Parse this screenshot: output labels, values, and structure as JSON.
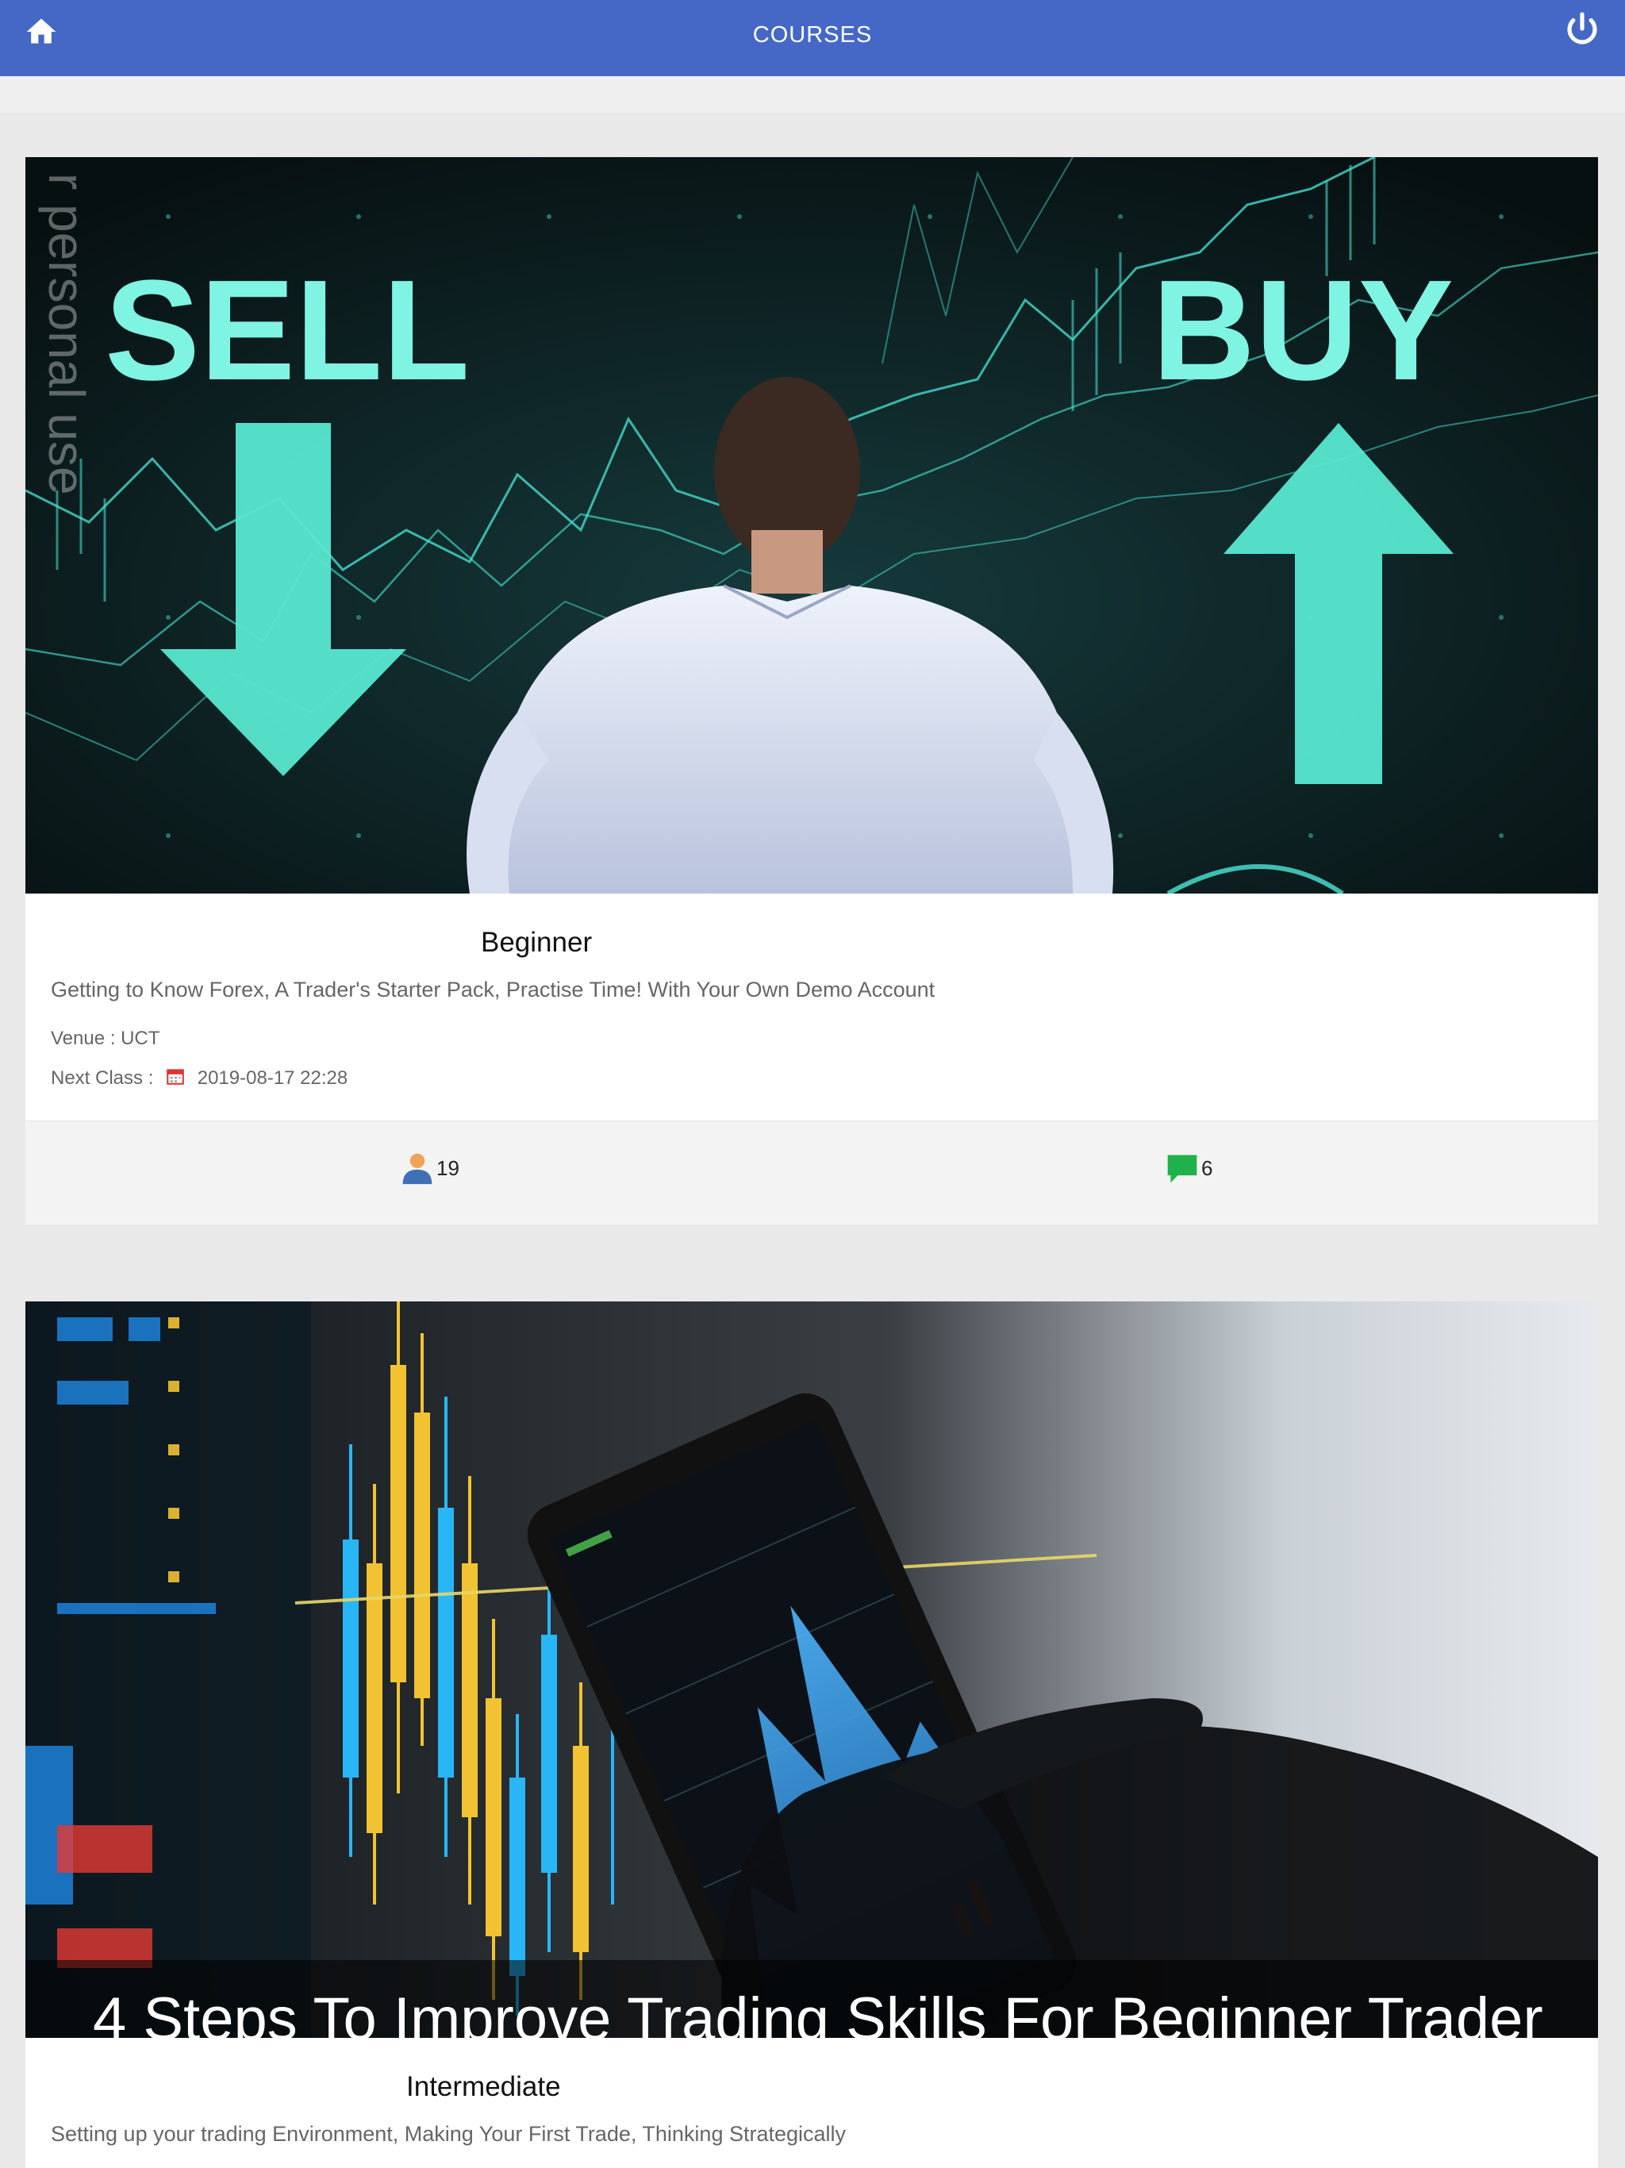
{
  "header": {
    "title": "COURSES",
    "home_icon": "home-icon",
    "power_icon": "power-icon"
  },
  "courses": [
    {
      "level": "Beginner",
      "description": "Getting to Know Forex, A Trader's Starter Pack, Practise Time! With Your Own Demo Account",
      "venue_label": "Venue :",
      "venue": "UCT",
      "next_class_label": "Next Class :",
      "next_class": "2019-08-17 22:28",
      "attendees": "19",
      "comments": "6",
      "image_text": {
        "left": "SELL",
        "right": "BUY"
      }
    },
    {
      "level": "Intermediate",
      "description": "Setting up your trading Environment, Making Your First Trade, Thinking Strategically",
      "image_caption": "4 Steps To Improve Trading Skills For Beginner Trader"
    }
  ],
  "side_watermark": "r personal use",
  "colors": {
    "header": "#4568c7",
    "accent_teal": "#5ff0d8",
    "comment_green": "#20b14b",
    "user_orange": "#f0a35a",
    "user_blue": "#3f6fb5"
  }
}
